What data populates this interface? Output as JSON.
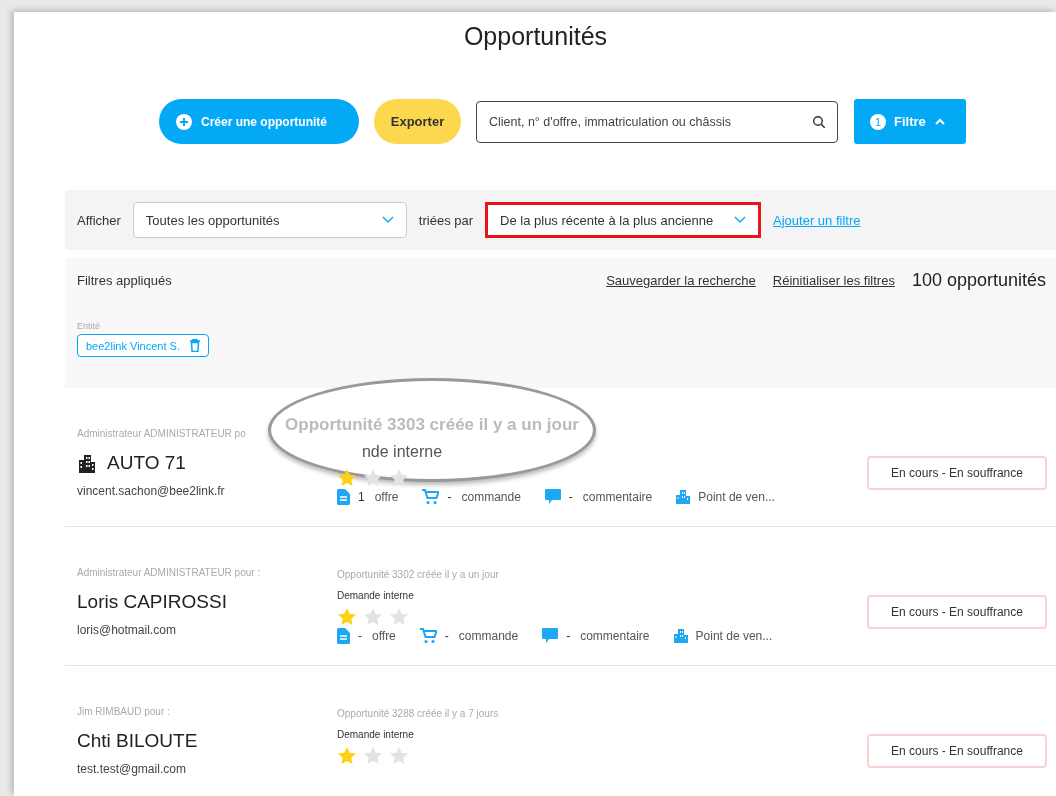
{
  "page_title": "Opportunités",
  "toolbar": {
    "create_button": "Créer une opportunité",
    "export_button": "Exporter",
    "search": {
      "placeholder": "Client, n° d'offre, immatriculation ou châssis"
    },
    "filter_button": {
      "count": "1",
      "label": "Filtre",
      "expanded": true
    }
  },
  "filter_bar": {
    "show_label": "Afficher",
    "show_select": "Toutes les opportunités",
    "sort_label": "triées par",
    "sort_select": {
      "value": "De la plus récente à la plus ancienne",
      "highlighted": true
    },
    "add_filter_link": "Ajouter un filtre"
  },
  "applied_filters": {
    "title": "Filtres appliqués",
    "save_link": "Sauvegarder la recherche",
    "reset_link": "Réinitialiser les filtres",
    "count": "100 opportunités",
    "chips": [
      {
        "label": "Entité",
        "value": "bee2link Vincent S."
      }
    ]
  },
  "opportunities": [
    {
      "author": "Administrateur ADMINISTRATEUR po",
      "client": "AUTO 71",
      "company": true,
      "email": "vincent.sachon@bee2link.fr",
      "stars": 1,
      "meta": {
        "offers": "1",
        "offers_label": "offre",
        "orders": "-",
        "orders_label": "commande",
        "comments": "-",
        "comments_label": "commentaire",
        "point": "Point de ven..."
      },
      "status": "En cours - En souffrance",
      "magnifier": {
        "title": "Opportunité 3303 créée il y a un jour",
        "type": "nde interne"
      }
    },
    {
      "author": "Administrateur ADMINISTRATEUR pour :",
      "client": "Loris CAPIROSSI",
      "company": false,
      "email": "loris@hotmail.com",
      "title": "Opportunité 3302 créée il y a un jour",
      "type": "Demande interne",
      "stars": 1,
      "meta": {
        "offers": "-",
        "offers_label": "offre",
        "orders": "-",
        "orders_label": "commande",
        "comments": "-",
        "comments_label": "commentaire",
        "point": "Point de ven..."
      },
      "status": "En cours - En souffrance"
    },
    {
      "author": "Jim RIMBAUD pour :",
      "client": "Chti BILOUTE",
      "company": false,
      "email": "test.test@gmail.com",
      "title": "Opportunité 3288 créée il y a 7 jours",
      "type": "Demande interne",
      "stars": 1,
      "status": "En cours - En souffrance"
    }
  ]
}
